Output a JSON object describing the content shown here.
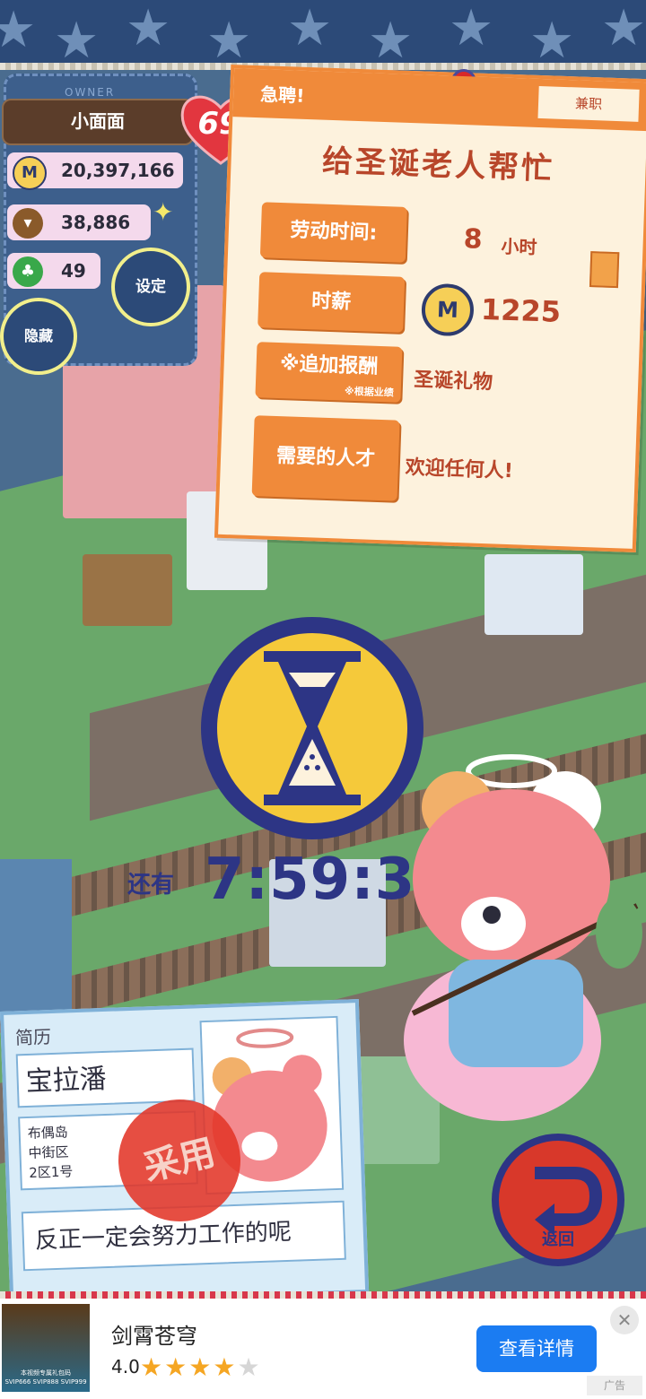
{
  "owner": {
    "label": "OWNER",
    "name": "小面面",
    "level": "69",
    "coins": "20,397,166",
    "crops": "38,886",
    "clovers": "49",
    "settings_label": "设定",
    "hide_label": "隐藏"
  },
  "job": {
    "urgent_label": "急聘!",
    "type_label": "兼职",
    "title": "给圣诞老人帮忙",
    "hours_label": "劳动时间:",
    "hours_value": "8",
    "hours_unit": "小时",
    "wage_label": "时薪",
    "wage_value": "1225",
    "bonus_label": "※追加报酬",
    "bonus_note": "※根据业绩",
    "bonus_value": "圣诞礼物",
    "talent_label": "需要的人才",
    "talent_value": "欢迎任何人!"
  },
  "timer": {
    "remain_label": "还有",
    "value": "7:59:30"
  },
  "resume": {
    "title": "简历",
    "name": "宝拉潘",
    "address": [
      "布偶岛",
      "中街区",
      "2区1号"
    ],
    "motto": "反正一定会努力工作的呢",
    "stamp_label": "采用"
  },
  "back_label": "返回",
  "ad": {
    "thumb_text": [
      "本视频专属礼包码",
      "SVIP666 SVIP888 SVIP999"
    ],
    "title": "剑霄苍穹",
    "rating": "4.0",
    "stars_filled": 4,
    "stars_total": 5,
    "button_label": "查看详情",
    "close_symbol": "✕",
    "tag": "广告"
  },
  "colors": {
    "accent_orange": "#f08a3a",
    "navy": "#2d3585",
    "ad_blue": "#1b7cf2"
  }
}
